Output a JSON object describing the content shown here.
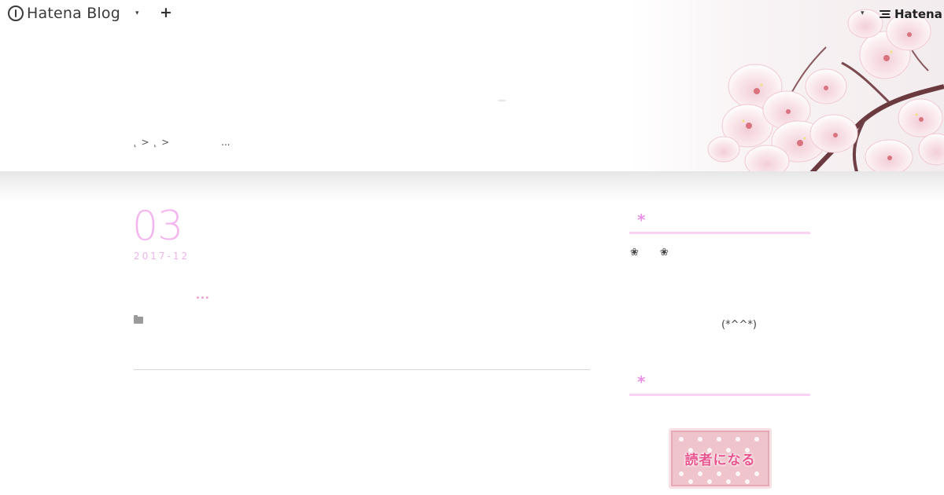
{
  "topbar": {
    "brand": "Hatena Blog",
    "menu_caret": "▾",
    "add_label": "+",
    "user_caret": "▾",
    "hatena_brand": "Hatena"
  },
  "header": {
    "breadcrumb": {
      "dot1": "⸤",
      "sep1": ">",
      "dot2": "⸤",
      "sep2": ">",
      "ellipsis": "..."
    }
  },
  "entry": {
    "date_day": "03",
    "date_year_month": "2017-12",
    "title_ellipsis": "...",
    "category_icon": "folder-icon"
  },
  "sidebar": {
    "profile_title_star": "*",
    "profile_flower_left": "❀",
    "profile_flower_right": "❀",
    "profile_face": "(*^^*)",
    "subscribe_title_star": "*",
    "subscribe_label": "読者になる"
  },
  "colors": {
    "accent_pink": "#f4b6ef",
    "title_link": "#ee8fc8",
    "module_border": "#f9d2f4",
    "module_star": "#e98fe8",
    "subscribe_bg": "#efc4cc",
    "subscribe_text": "#e8558e"
  }
}
